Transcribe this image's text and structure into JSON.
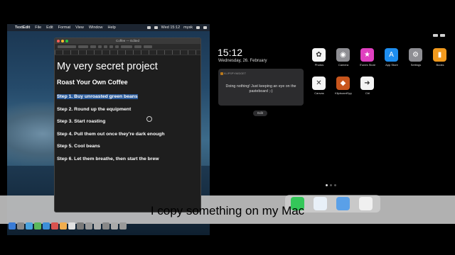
{
  "mac": {
    "menubar": {
      "apple": "",
      "items": [
        "TextEdit",
        "File",
        "Edit",
        "Format",
        "View",
        "Window",
        "Help"
      ],
      "clock": "Wed 15:12",
      "user": "mysk"
    },
    "textedit": {
      "window_title": "Coffee — Edited",
      "document": {
        "title": "My very secret project",
        "subtitle": "Roast Your Own Coffee",
        "steps": [
          "Step 1. Buy unroasted green beans",
          "Step 2. Round up the equipment",
          "Step 3. Start roasting",
          "Step 4. Pull them out once they're dark enough",
          "Step 5. Cool beans",
          "Step 6. Let them breathe, then start the brew"
        ],
        "selected_step_index": 0
      }
    }
  },
  "ipad": {
    "time": "15:12",
    "date": "Wednesday, 26. February",
    "notification": {
      "app": "KLIPSPYWIDGET",
      "message": "Doing nothing! Just keeping an eye on the pasteboard ;-)"
    },
    "edit_label": "Edit",
    "apps": [
      {
        "label": "Photos",
        "icon": "photos-icon",
        "color": "#f4f4f4",
        "glyph": "✿"
      },
      {
        "label": "Camera",
        "icon": "camera-icon",
        "color": "#8e8e93",
        "glyph": "◉"
      },
      {
        "label": "iTunes Store",
        "icon": "itunes-icon",
        "color": "#e040c0",
        "glyph": "★"
      },
      {
        "label": "App Store",
        "icon": "appstore-icon",
        "color": "#1e8ef0",
        "glyph": "A"
      },
      {
        "label": "Settings",
        "icon": "settings-icon",
        "color": "#8e8e93",
        "glyph": "⚙"
      },
      {
        "label": "Books",
        "icon": "books-icon",
        "color": "#f29a1e",
        "glyph": "▮"
      },
      {
        "label": "Canvas",
        "icon": "canvas-icon",
        "color": "#f4f4f4",
        "glyph": "✕"
      },
      {
        "label": "KlipboardSpy",
        "icon": "klipboardspy-icon",
        "color": "#c8551c",
        "glyph": "◆"
      },
      {
        "label": "Ctrl",
        "icon": "ctrl-icon",
        "color": "#f4f4f4",
        "glyph": "➜"
      }
    ],
    "dock_apps": [
      "messages-icon",
      "safari-icon",
      "mail-icon",
      "music-icon"
    ]
  },
  "caption": "I copy something on my Mac",
  "colors": {
    "selection": "#2a5a9a",
    "caption_bg": "#bebebe"
  }
}
